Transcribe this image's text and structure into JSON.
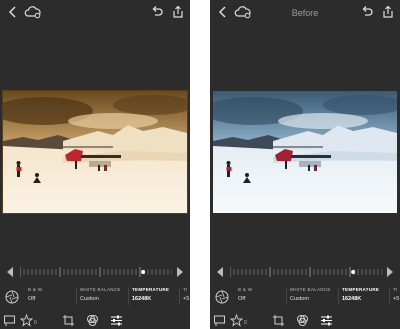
{
  "screens": [
    {
      "title": "",
      "icons": [
        "back-icon",
        "cloud-sync-icon",
        "undo-icon",
        "share-icon"
      ],
      "params": [
        {
          "label": "B & W",
          "value": "Off"
        },
        {
          "label": "WHITE BALANCE",
          "value": "Custom"
        },
        {
          "label": "TEMPERATURE",
          "value": "16248K",
          "active": true
        },
        {
          "label": "TI",
          "value": "+5"
        }
      ],
      "flag_count": "",
      "star_count": "0"
    },
    {
      "title": "Before",
      "icons": [
        "back-icon",
        "cloud-sync-icon",
        "undo-icon",
        "share-icon"
      ],
      "params": [
        {
          "label": "B & W",
          "value": "Off"
        },
        {
          "label": "WHITE BALANCE",
          "value": "Custom"
        },
        {
          "label": "TEMPERATURE",
          "value": "16248K",
          "active": true
        },
        {
          "label": "TI",
          "value": "+5"
        }
      ],
      "flag_count": "",
      "star_count": "0"
    }
  ],
  "slider": {
    "level": 0.81
  },
  "colors": {
    "background": "#2c2c2c",
    "warm_sky": "#c9a36a",
    "cool_sky": "#8fb2cc",
    "helicopter": "#c0262e",
    "tick": "#8a8a8a",
    "tick_active": "#ffffff"
  }
}
